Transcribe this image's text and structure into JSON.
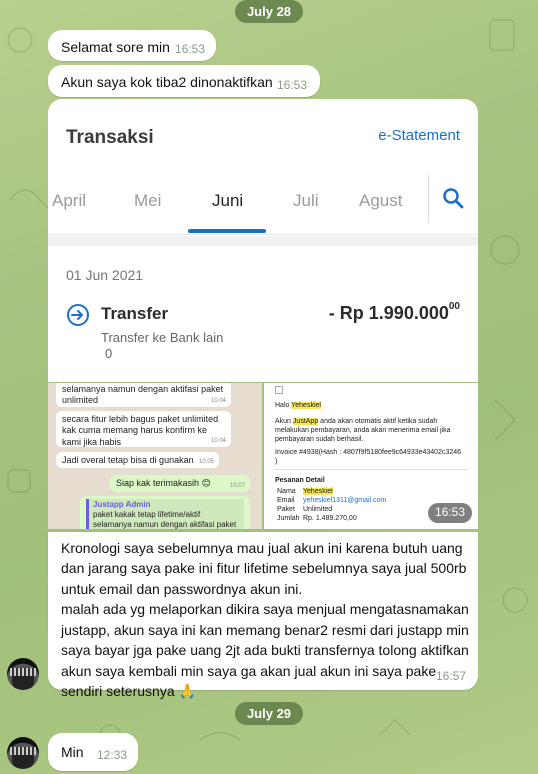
{
  "dates": {
    "first": "July 28",
    "second": "July 29"
  },
  "messages": [
    {
      "text": "Selamat sore min",
      "time": "16:53"
    },
    {
      "text": "Akun saya kok tiba2 dinonaktifkan",
      "time": "16:53"
    }
  ],
  "bank": {
    "title": "Transaksi",
    "estatement": "e-Statement",
    "months": [
      "April",
      "Mei",
      "Juni",
      "Juli",
      "Agust"
    ],
    "active_month": "Juni",
    "tx_date": "01 Jun 2021",
    "tx_name": "Transfer",
    "tx_amount": "- Rp 1.990.000",
    "tx_amount_cents": "00",
    "tx_sub": "Transfer ke Bank lain",
    "tx_zero": "0"
  },
  "chat_image": {
    "m1": "selamanya namun dengan aktifasi paket unlimited",
    "m1_time": "10.04",
    "m2": "secara fitur lebih bagus paket unlimited kak cuma memang harus konfirm ke kami jika habis",
    "m2_time": "10.04",
    "m3": "Jadi overal tetap bisa di gunakan",
    "m3_time": "10.05",
    "m4": "Siap kak terimakasih 😊",
    "m4_time": "10.07",
    "reply_name": "Justapp Admin",
    "reply_text": "paket kakak tetap lifetime/aktif selamanya namun dengan aktifasi paket unlimited"
  },
  "invoice": {
    "halo": "Halo",
    "name": "Yeheskiel",
    "line1a": "Akun",
    "app": "JustApp",
    "line1b": "anda akan otomatis aktif ketika sudah melakukan pembayaran, anda akan menerima email jika pembayaran sudah berhasil.",
    "invoice_line": "Invoice #4938(Hash : 4807f9f5180fee9c64933e43402c3246 )",
    "section": "Pesanan Detail",
    "rows": [
      {
        "k": "Nama",
        "v": "Yeheskiel"
      },
      {
        "k": "Email",
        "v": "yeheskiel1311@gmail.com"
      },
      {
        "k": "Paket",
        "v": "Unlimited"
      },
      {
        "k": "Jumlah",
        "v": "Rp. 1.489.270,00"
      }
    ],
    "time": "16:53"
  },
  "long_message": {
    "p1": "Kronologi saya sebelumnya mau jual akun ini karena butuh uang dan jarang saya pake ini fitur lifetime sebelumnya saya jual 500rb untuk email dan passwordnya akun ini.",
    "p2": "malah ada yg melaporkan dikira saya menjual mengatasnamakan justapp, akun saya ini kan memang benar2 resmi dari justapp min saya bayar jga pake uang 2jt ada bukti transfernya tolong aktifkan akun saya kembali min saya ga akan jual akun ini saya pake sendiri seterusnya 🙏",
    "time": "16:57"
  },
  "last_message": {
    "text": "Min",
    "time": "12:33"
  },
  "colors": {
    "accent": "#1b6fc7",
    "date_pill": "#607d46"
  }
}
